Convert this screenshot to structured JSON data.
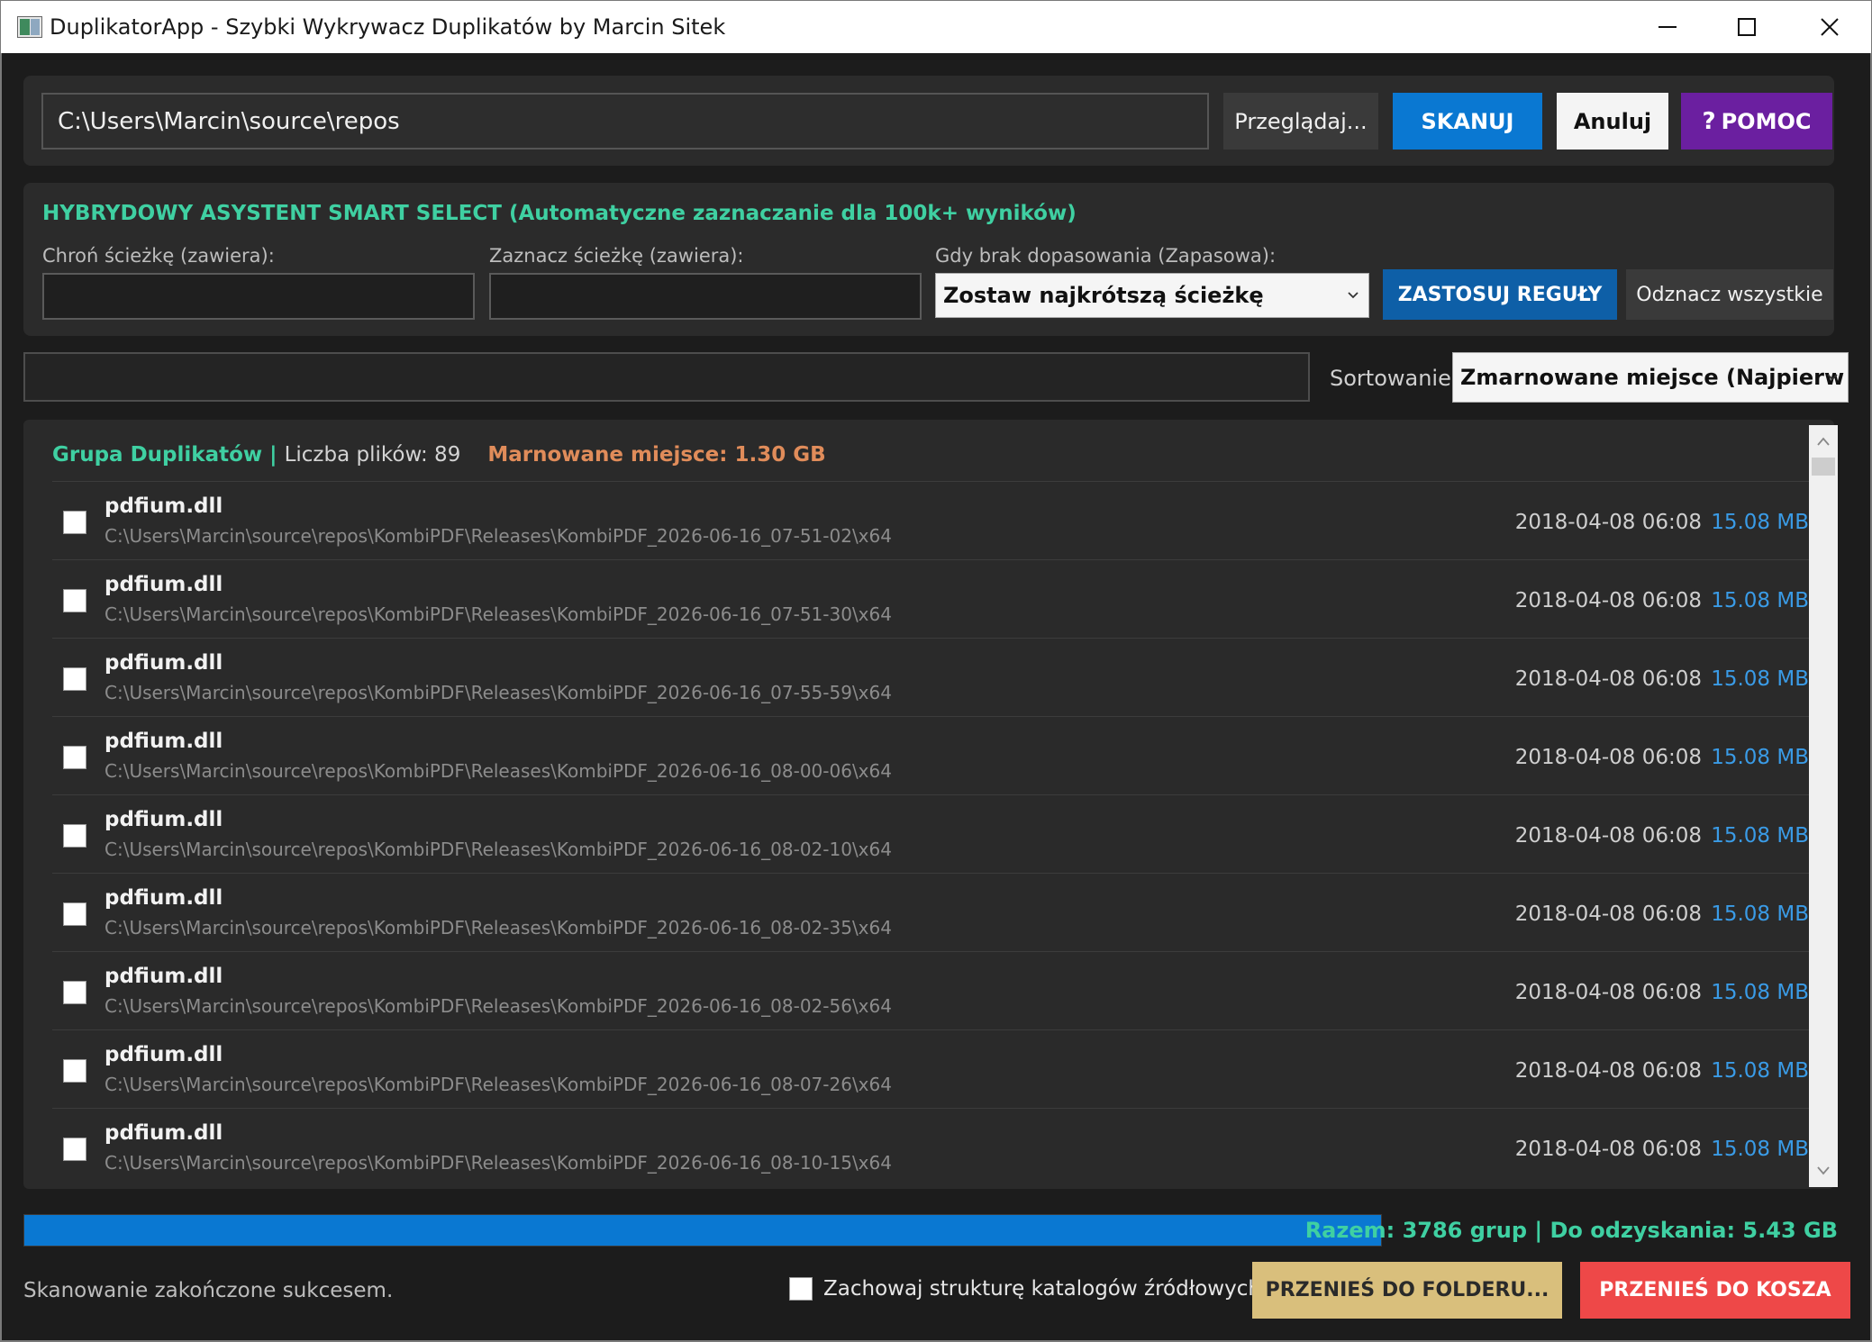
{
  "window": {
    "title": "DuplikatorApp - Szybki Wykrywacz Duplikatów by Marcin Sitek"
  },
  "toolbar": {
    "path": "C:\\Users\\Marcin\\source\\repos",
    "browse_label": "Przeglądaj...",
    "scan_label": "SKANUJ",
    "cancel_label": "Anuluj",
    "help_label": "POMOC"
  },
  "smart_select": {
    "title": "HYBRYDOWY ASYSTENT SMART SELECT (Automatyczne zaznaczanie dla 100k+ wyników)",
    "protect_label": "Chroń ścieżkę (zawiera):",
    "protect_value": "",
    "mark_label": "Zaznacz ścieżkę (zawiera):",
    "mark_value": "",
    "fallback_label": "Gdy brak dopasowania (Zapasowa):",
    "fallback_value": "Zostaw najkrótszą ścieżkę",
    "apply_label": "ZASTOSUJ REGUŁY",
    "uncheck_label": "Odznacz wszystkie"
  },
  "filter": {
    "value": "",
    "sort_label": "Sortowanie:",
    "sort_value": "Zmarnowane miejsce (Najpierw na"
  },
  "group": {
    "title": "Grupa Duplikatów",
    "separator": "|",
    "count_text": "Liczba plików: 89",
    "wasted_text": "Marnowane miejsce: 1.30 GB",
    "files": [
      {
        "name": "pdfium.dll",
        "path": "C:\\Users\\Marcin\\source\\repos\\KombiPDF\\Releases\\KombiPDF_2026-06-16_07-51-02\\x64",
        "date": "2018-04-08 06:08",
        "size": "15.08 MB",
        "checked": false
      },
      {
        "name": "pdfium.dll",
        "path": "C:\\Users\\Marcin\\source\\repos\\KombiPDF\\Releases\\KombiPDF_2026-06-16_07-51-30\\x64",
        "date": "2018-04-08 06:08",
        "size": "15.08 MB",
        "checked": false
      },
      {
        "name": "pdfium.dll",
        "path": "C:\\Users\\Marcin\\source\\repos\\KombiPDF\\Releases\\KombiPDF_2026-06-16_07-55-59\\x64",
        "date": "2018-04-08 06:08",
        "size": "15.08 MB",
        "checked": false
      },
      {
        "name": "pdfium.dll",
        "path": "C:\\Users\\Marcin\\source\\repos\\KombiPDF\\Releases\\KombiPDF_2026-06-16_08-00-06\\x64",
        "date": "2018-04-08 06:08",
        "size": "15.08 MB",
        "checked": false
      },
      {
        "name": "pdfium.dll",
        "path": "C:\\Users\\Marcin\\source\\repos\\KombiPDF\\Releases\\KombiPDF_2026-06-16_08-02-10\\x64",
        "date": "2018-04-08 06:08",
        "size": "15.08 MB",
        "checked": false
      },
      {
        "name": "pdfium.dll",
        "path": "C:\\Users\\Marcin\\source\\repos\\KombiPDF\\Releases\\KombiPDF_2026-06-16_08-02-35\\x64",
        "date": "2018-04-08 06:08",
        "size": "15.08 MB",
        "checked": false
      },
      {
        "name": "pdfium.dll",
        "path": "C:\\Users\\Marcin\\source\\repos\\KombiPDF\\Releases\\KombiPDF_2026-06-16_08-02-56\\x64",
        "date": "2018-04-08 06:08",
        "size": "15.08 MB",
        "checked": false
      },
      {
        "name": "pdfium.dll",
        "path": "C:\\Users\\Marcin\\source\\repos\\KombiPDF\\Releases\\KombiPDF_2026-06-16_08-07-26\\x64",
        "date": "2018-04-08 06:08",
        "size": "15.08 MB",
        "checked": false
      },
      {
        "name": "pdfium.dll",
        "path": "C:\\Users\\Marcin\\source\\repos\\KombiPDF\\Releases\\KombiPDF_2026-06-16_08-10-15\\x64",
        "date": "2018-04-08 06:08",
        "size": "15.08 MB",
        "checked": false
      }
    ]
  },
  "summary": {
    "progress": 1.0,
    "totals_text": "Razem: 3786 grup | Do odzyskania: 5.43 GB"
  },
  "footer": {
    "status": "Skanowanie zakończone sukcesem.",
    "keep_structure_label": "Zachowaj strukturę katalogów źródłowych",
    "keep_structure_checked": false,
    "move_folder_label": "PRZENIEŚ DO FOLDERU...",
    "move_trash_label": "PRZENIEŚ DO KOSZA"
  },
  "colors": {
    "accent_green": "#3fd0a2",
    "accent_blue": "#0a78d2",
    "wasted_orange": "#e08c5a",
    "help_purple": "#6b1fa0",
    "trash_red": "#ee4848",
    "folder_gold": "#d9bf7c"
  },
  "icons": {
    "app": "app-icon",
    "help": "question-icon",
    "dropdown": "chevron-down-icon"
  }
}
